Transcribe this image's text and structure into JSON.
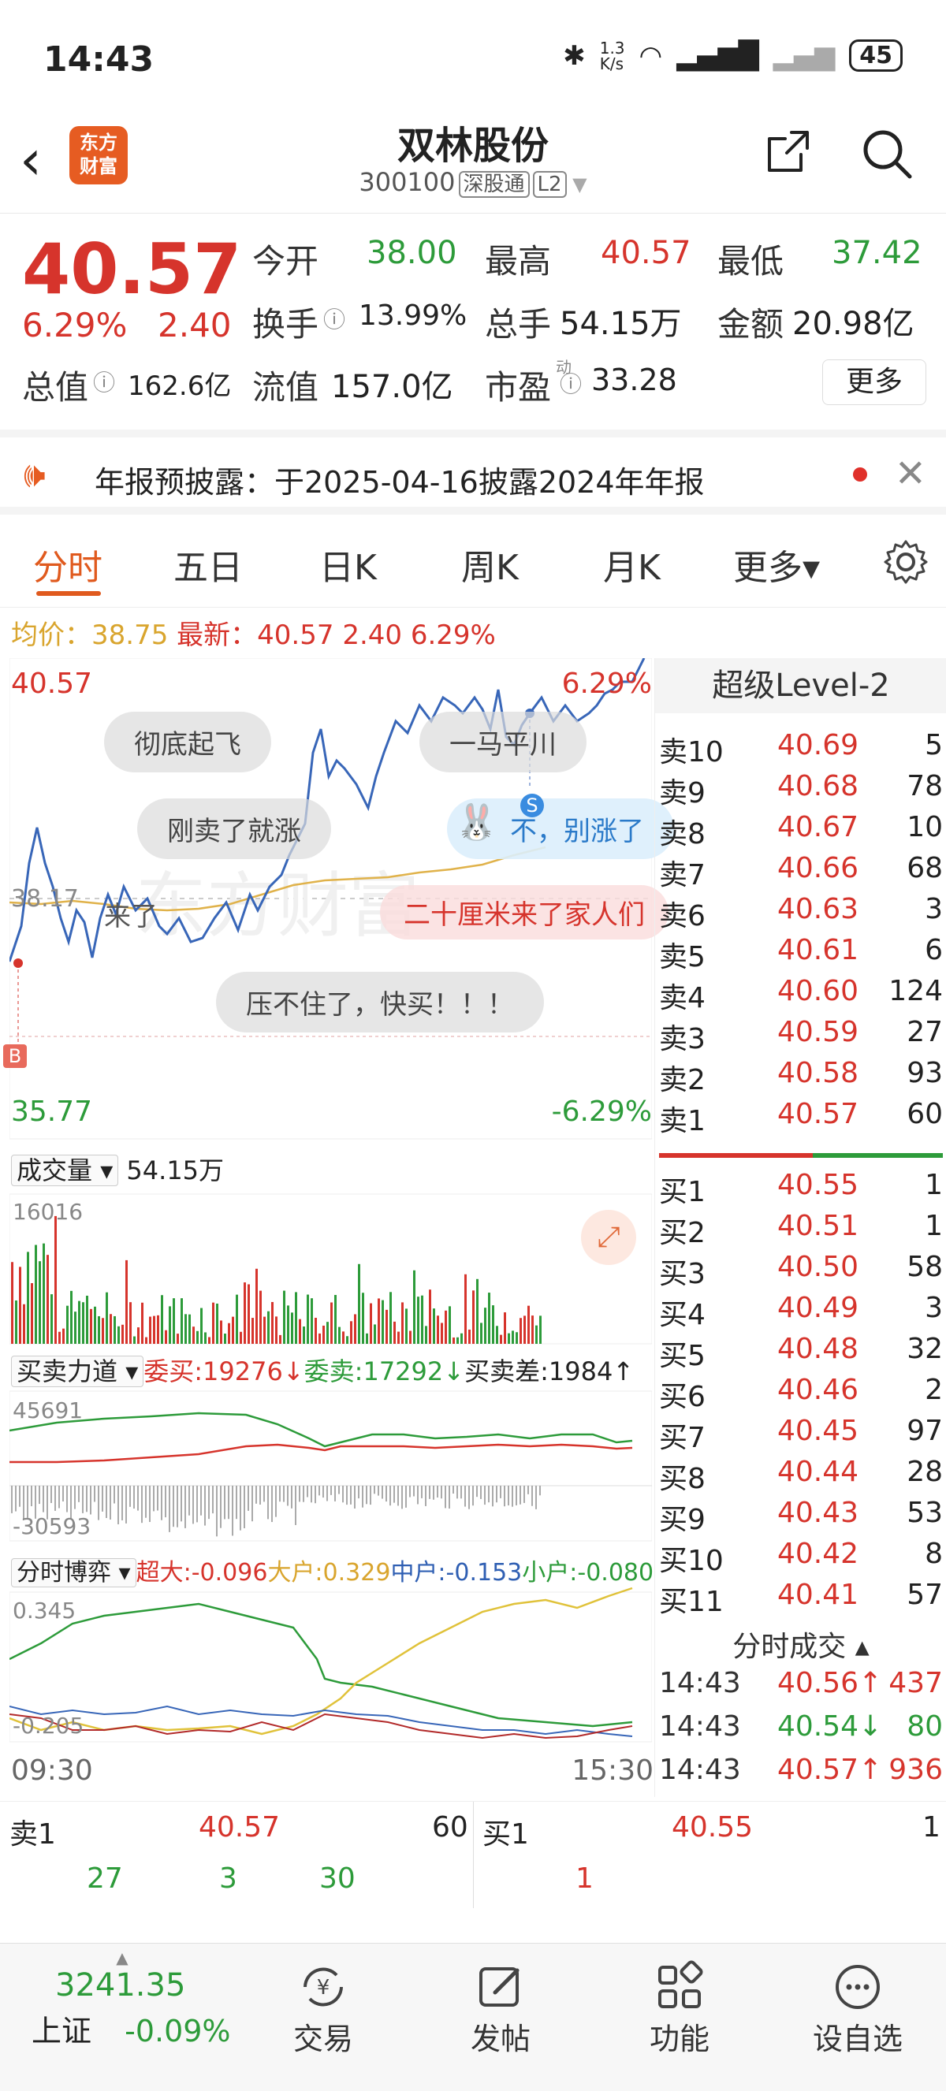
{
  "status": {
    "time": "14:43",
    "net_speed": "1.3\nK/s",
    "battery": "45"
  },
  "header": {
    "name": "双林股份",
    "code": "300100",
    "tag1": "深股通",
    "tag2": "L2",
    "logo": "东方\n财富"
  },
  "quote": {
    "price": "40.57",
    "change_pct": "6.29%",
    "change_abs": "2.40",
    "open_label": "今开",
    "open": "38.00",
    "high_label": "最高",
    "high": "40.57",
    "low_label": "最低",
    "low": "37.42",
    "turnover_label": "换手",
    "turnover": "13.99%",
    "volume_label": "总手",
    "volume": "54.15万",
    "amount_label": "金额",
    "amount": "20.98亿",
    "mktcap_label": "总值",
    "mktcap": "162.6亿",
    "float_label": "流值",
    "float": "157.0亿",
    "pe_label": "市盈",
    "pe_sup": "动",
    "pe": "33.28",
    "more": "更多"
  },
  "notice": {
    "text": "年报预披露：于2025-04-16披露2024年年报"
  },
  "tabs": [
    "分时",
    "五日",
    "日K",
    "周K",
    "月K",
    "更多▾"
  ],
  "avg_line": {
    "avg_label": "均价：",
    "avg": "38.75",
    "latest_label": "最新：",
    "latest": "40.57",
    "chg": "2.40",
    "pct": "6.29%"
  },
  "chart": {
    "y_top": "40.57",
    "y_top_pct": "6.29%",
    "y_bottom": "35.77",
    "y_bottom_pct": "-6.29%",
    "mid_label": "38.17",
    "bubbles": [
      "彻底起飞",
      "一马平川",
      "刚卖了就涨",
      "不，别涨了",
      "来了",
      "二十厘米来了家人们",
      "压不住了，快买！！！"
    ],
    "marker_b": "B",
    "marker_s": "S"
  },
  "volume_panel": {
    "label": "成交量",
    "value": "54.15万",
    "max": "16016"
  },
  "force_panel": {
    "label": "买卖力道",
    "buy_label": "委买:",
    "buy": "19276",
    "sell_label": "委卖:",
    "sell": "17292",
    "diff_label": "买卖差:",
    "diff": "1984",
    "max": "45691",
    "min": "-30593"
  },
  "game_panel": {
    "label": "分时博弈",
    "super_label": "超大:",
    "super": "-0.096",
    "large_label": "大户:",
    "large": "0.329",
    "mid_label": "中户:",
    "mid": "-0.153",
    "small_label": "小户:",
    "small": "-0.080",
    "max": "0.345",
    "min": "-0.205"
  },
  "time_axis": {
    "start": "09:30",
    "end": "15:30"
  },
  "level2": {
    "title": "超级Level-2",
    "asks": [
      {
        "label": "卖10",
        "price": "40.69",
        "qty": "5"
      },
      {
        "label": "卖9",
        "price": "40.68",
        "qty": "78"
      },
      {
        "label": "卖8",
        "price": "40.67",
        "qty": "10"
      },
      {
        "label": "卖7",
        "price": "40.66",
        "qty": "68"
      },
      {
        "label": "卖6",
        "price": "40.63",
        "qty": "3"
      },
      {
        "label": "卖5",
        "price": "40.61",
        "qty": "6"
      },
      {
        "label": "卖4",
        "price": "40.60",
        "qty": "124"
      },
      {
        "label": "卖3",
        "price": "40.59",
        "qty": "27"
      },
      {
        "label": "卖2",
        "price": "40.58",
        "qty": "93"
      },
      {
        "label": "卖1",
        "price": "40.57",
        "qty": "60"
      }
    ],
    "bids": [
      {
        "label": "买1",
        "price": "40.55",
        "qty": "1"
      },
      {
        "label": "买2",
        "price": "40.51",
        "qty": "1"
      },
      {
        "label": "买3",
        "price": "40.50",
        "qty": "58"
      },
      {
        "label": "买4",
        "price": "40.49",
        "qty": "3"
      },
      {
        "label": "买5",
        "price": "40.48",
        "qty": "32"
      },
      {
        "label": "买6",
        "price": "40.46",
        "qty": "2"
      },
      {
        "label": "买7",
        "price": "40.45",
        "qty": "97"
      },
      {
        "label": "买8",
        "price": "40.44",
        "qty": "28"
      },
      {
        "label": "买9",
        "price": "40.43",
        "qty": "53"
      },
      {
        "label": "买10",
        "price": "40.42",
        "qty": "8"
      },
      {
        "label": "买11",
        "price": "40.41",
        "qty": "57"
      }
    ],
    "trades_title": "分时成交 ▴",
    "trades": [
      {
        "time": "14:43",
        "price": "40.56↑",
        "vol": "437",
        "dir": "up"
      },
      {
        "time": "14:43",
        "price": "40.54↓",
        "vol": "80",
        "dir": "down"
      },
      {
        "time": "14:43",
        "price": "40.57↑",
        "vol": "936",
        "dir": "up"
      }
    ]
  },
  "bidask": {
    "sell_label": "卖1",
    "sell_price": "40.57",
    "sell_qty": "60",
    "buy_label": "买1",
    "buy_price": "40.55",
    "buy_qty": "1",
    "sell_orders": [
      "27",
      "3",
      "30"
    ],
    "buy_orders": [
      "1"
    ]
  },
  "bottom_nav": {
    "index_value": "3241.35",
    "index_name": "上证",
    "index_pct": "-0.09%",
    "items": [
      "交易",
      "发帖",
      "功能",
      "设自选"
    ]
  }
}
